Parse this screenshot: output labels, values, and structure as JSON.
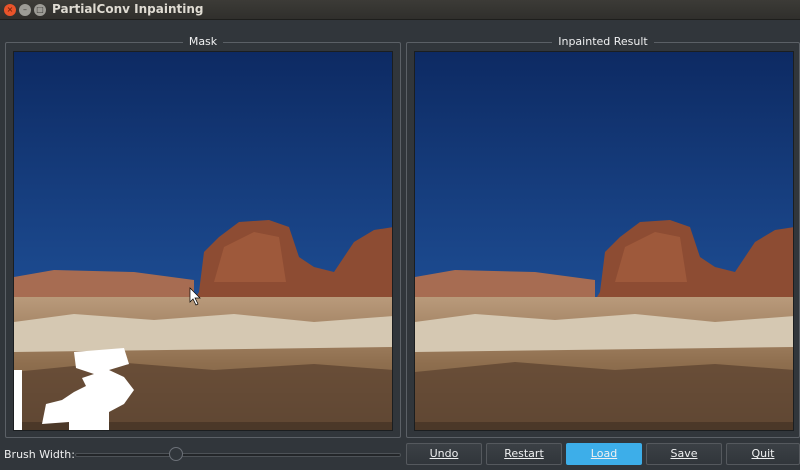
{
  "window": {
    "title": "PartialConv Inpainting",
    "close_glyph": "×",
    "minimize_glyph": "–",
    "maximize_glyph": "□"
  },
  "panels": {
    "mask_title": "Mask",
    "result_title": "Inpainted Result"
  },
  "controls": {
    "brush_width_label": "Brush Width:",
    "brush_width_value": 0.3
  },
  "buttons": {
    "undo": "Undo",
    "restart": "Restart",
    "load": "Load",
    "save": "Save",
    "quit": "Quit"
  },
  "colors": {
    "accent": "#3daee9",
    "window_bg": "#31363b",
    "mask_paint": "#ffffff"
  }
}
